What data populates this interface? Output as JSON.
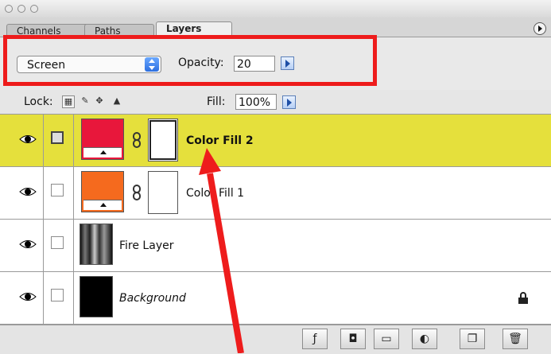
{
  "tabs": [
    {
      "label": "Channels"
    },
    {
      "label": "Paths"
    },
    {
      "label": "Layers"
    }
  ],
  "blend": {
    "mode": "Screen",
    "opacity_label": "Opacity:",
    "opacity_value": "20"
  },
  "lock": {
    "label": "Lock:",
    "fill_label": "Fill:",
    "fill_value": "100%"
  },
  "layers": [
    {
      "name": "Color Fill 2",
      "color": "#e8173b",
      "selected": true
    },
    {
      "name": "Color Fill 1",
      "color": "#f56a1e",
      "selected": false
    },
    {
      "name": "Fire Layer",
      "selected": false
    },
    {
      "name": "Background",
      "selected": false
    }
  ],
  "colors": {
    "highlight": "#ee1c1c",
    "selected_layer": "#e5e03c"
  }
}
